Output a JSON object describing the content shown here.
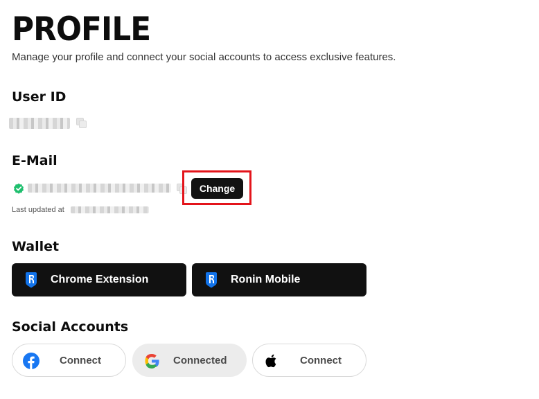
{
  "page": {
    "title": "PROFILE",
    "subtitle": "Manage your profile and connect your social accounts to access exclusive features."
  },
  "user_id": {
    "heading": "User ID",
    "copy_icon": "copy-icon"
  },
  "email": {
    "heading": "E-Mail",
    "verified_icon": "check-badge-icon",
    "change_label": "Change",
    "last_updated_label": "Last updated at"
  },
  "wallet": {
    "heading": "Wallet",
    "buttons": [
      {
        "label": "Chrome Extension",
        "icon": "ronin-icon"
      },
      {
        "label": "Ronin Mobile",
        "icon": "ronin-icon"
      }
    ]
  },
  "social": {
    "heading": "Social Accounts",
    "accounts": [
      {
        "provider_icon": "facebook-icon",
        "label": "Connect",
        "connected": false
      },
      {
        "provider_icon": "google-icon",
        "label": "Connected",
        "connected": true
      },
      {
        "provider_icon": "apple-icon",
        "label": "Connect",
        "connected": false
      }
    ]
  },
  "colors": {
    "highlight": "#e3141b",
    "button_dark": "#121212",
    "verified_green": "#1fbf6e",
    "ronin_blue": "#1273ea",
    "facebook_blue": "#1877f2"
  }
}
